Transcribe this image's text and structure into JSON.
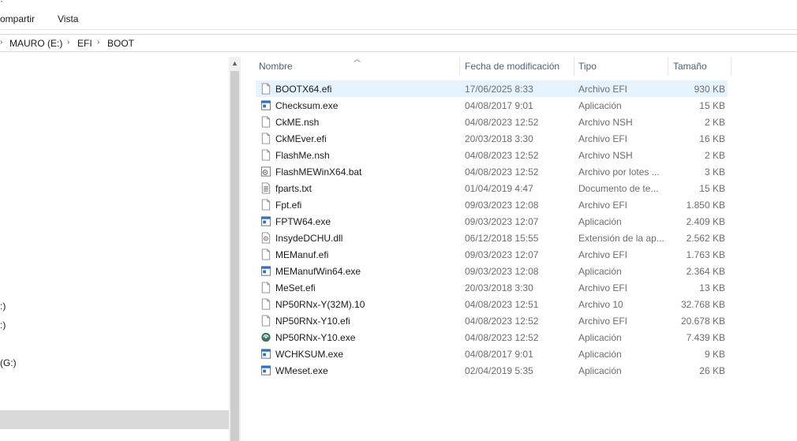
{
  "ribbon": {
    "top_glyph": "·",
    "tab_share": "ompartir",
    "tab_view": "Vista"
  },
  "breadcrumb": {
    "separator": "›",
    "items": [
      "MAURO (E:)",
      "EFI",
      "BOOT"
    ]
  },
  "nav_pane": {
    "items": [
      ":)",
      ":)",
      "(G:)"
    ]
  },
  "columns": {
    "name": "Nombre",
    "date": "Fecha de modificación",
    "type": "Tipo",
    "size": "Tamaño"
  },
  "files": [
    {
      "name": "BOOTX64.efi",
      "date": "17/06/2025 8:33",
      "type": "Archivo EFI",
      "size": "930 KB",
      "icon": "blank-file-icon"
    },
    {
      "name": "Checksum.exe",
      "date": "04/08/2017 9:01",
      "type": "Aplicación",
      "size": "15 KB",
      "icon": "application-icon"
    },
    {
      "name": "CkME.nsh",
      "date": "04/08/2023 12:52",
      "type": "Archivo NSH",
      "size": "2 KB",
      "icon": "blank-file-icon"
    },
    {
      "name": "CkMEver.efi",
      "date": "20/03/2018 3:30",
      "type": "Archivo EFI",
      "size": "16 KB",
      "icon": "blank-file-icon"
    },
    {
      "name": "FlashMe.nsh",
      "date": "04/08/2023 12:52",
      "type": "Archivo NSH",
      "size": "2 KB",
      "icon": "blank-file-icon"
    },
    {
      "name": "FlashMEWinX64.bat",
      "date": "04/08/2023 12:52",
      "type": "Archivo por lotes ...",
      "size": "3 KB",
      "icon": "batch-file-icon"
    },
    {
      "name": "fparts.txt",
      "date": "01/04/2019 4:47",
      "type": "Documento de te...",
      "size": "15 KB",
      "icon": "text-file-icon"
    },
    {
      "name": "Fpt.efi",
      "date": "09/03/2023 12:08",
      "type": "Archivo EFI",
      "size": "1.850 KB",
      "icon": "blank-file-icon"
    },
    {
      "name": "FPTW64.exe",
      "date": "09/03/2023 12:07",
      "type": "Aplicación",
      "size": "2.409 KB",
      "icon": "application-icon"
    },
    {
      "name": "InsydeDCHU.dll",
      "date": "06/12/2018 15:55",
      "type": "Extensión de la ap...",
      "size": "2.562 KB",
      "icon": "dll-file-icon"
    },
    {
      "name": "MEManuf.efi",
      "date": "09/03/2023 12:07",
      "type": "Archivo EFI",
      "size": "1.763 KB",
      "icon": "blank-file-icon"
    },
    {
      "name": "MEManufWin64.exe",
      "date": "09/03/2023 12:08",
      "type": "Aplicación",
      "size": "2.364 KB",
      "icon": "application-icon"
    },
    {
      "name": "MeSet.efi",
      "date": "20/03/2018 3:30",
      "type": "Archivo EFI",
      "size": "13 KB",
      "icon": "blank-file-icon"
    },
    {
      "name": "NP50RNx-Y(32M).10",
      "date": "04/08/2023 12:51",
      "type": "Archivo 10",
      "size": "32.768 KB",
      "icon": "blank-file-icon"
    },
    {
      "name": "NP50RNx-Y10.efi",
      "date": "04/08/2023 12:52",
      "type": "Archivo EFI",
      "size": "20.678 KB",
      "icon": "blank-file-icon"
    },
    {
      "name": "NP50RNx-Y10.exe",
      "date": "04/08/2023 12:52",
      "type": "Aplicación",
      "size": "7.439 KB",
      "icon": "flash-tool-icon"
    },
    {
      "name": "WCHKSUM.exe",
      "date": "04/08/2017 9:01",
      "type": "Aplicación",
      "size": "9 KB",
      "icon": "application-icon"
    },
    {
      "name": "WMeset.exe",
      "date": "02/04/2019 5:35",
      "type": "Aplicación",
      "size": "26 KB",
      "icon": "application-icon"
    }
  ],
  "selected_index": 0,
  "colors": {
    "selection": "#e5f3ff",
    "header_text": "#4c607a",
    "app_icon_blue": "#2a6fc9"
  }
}
